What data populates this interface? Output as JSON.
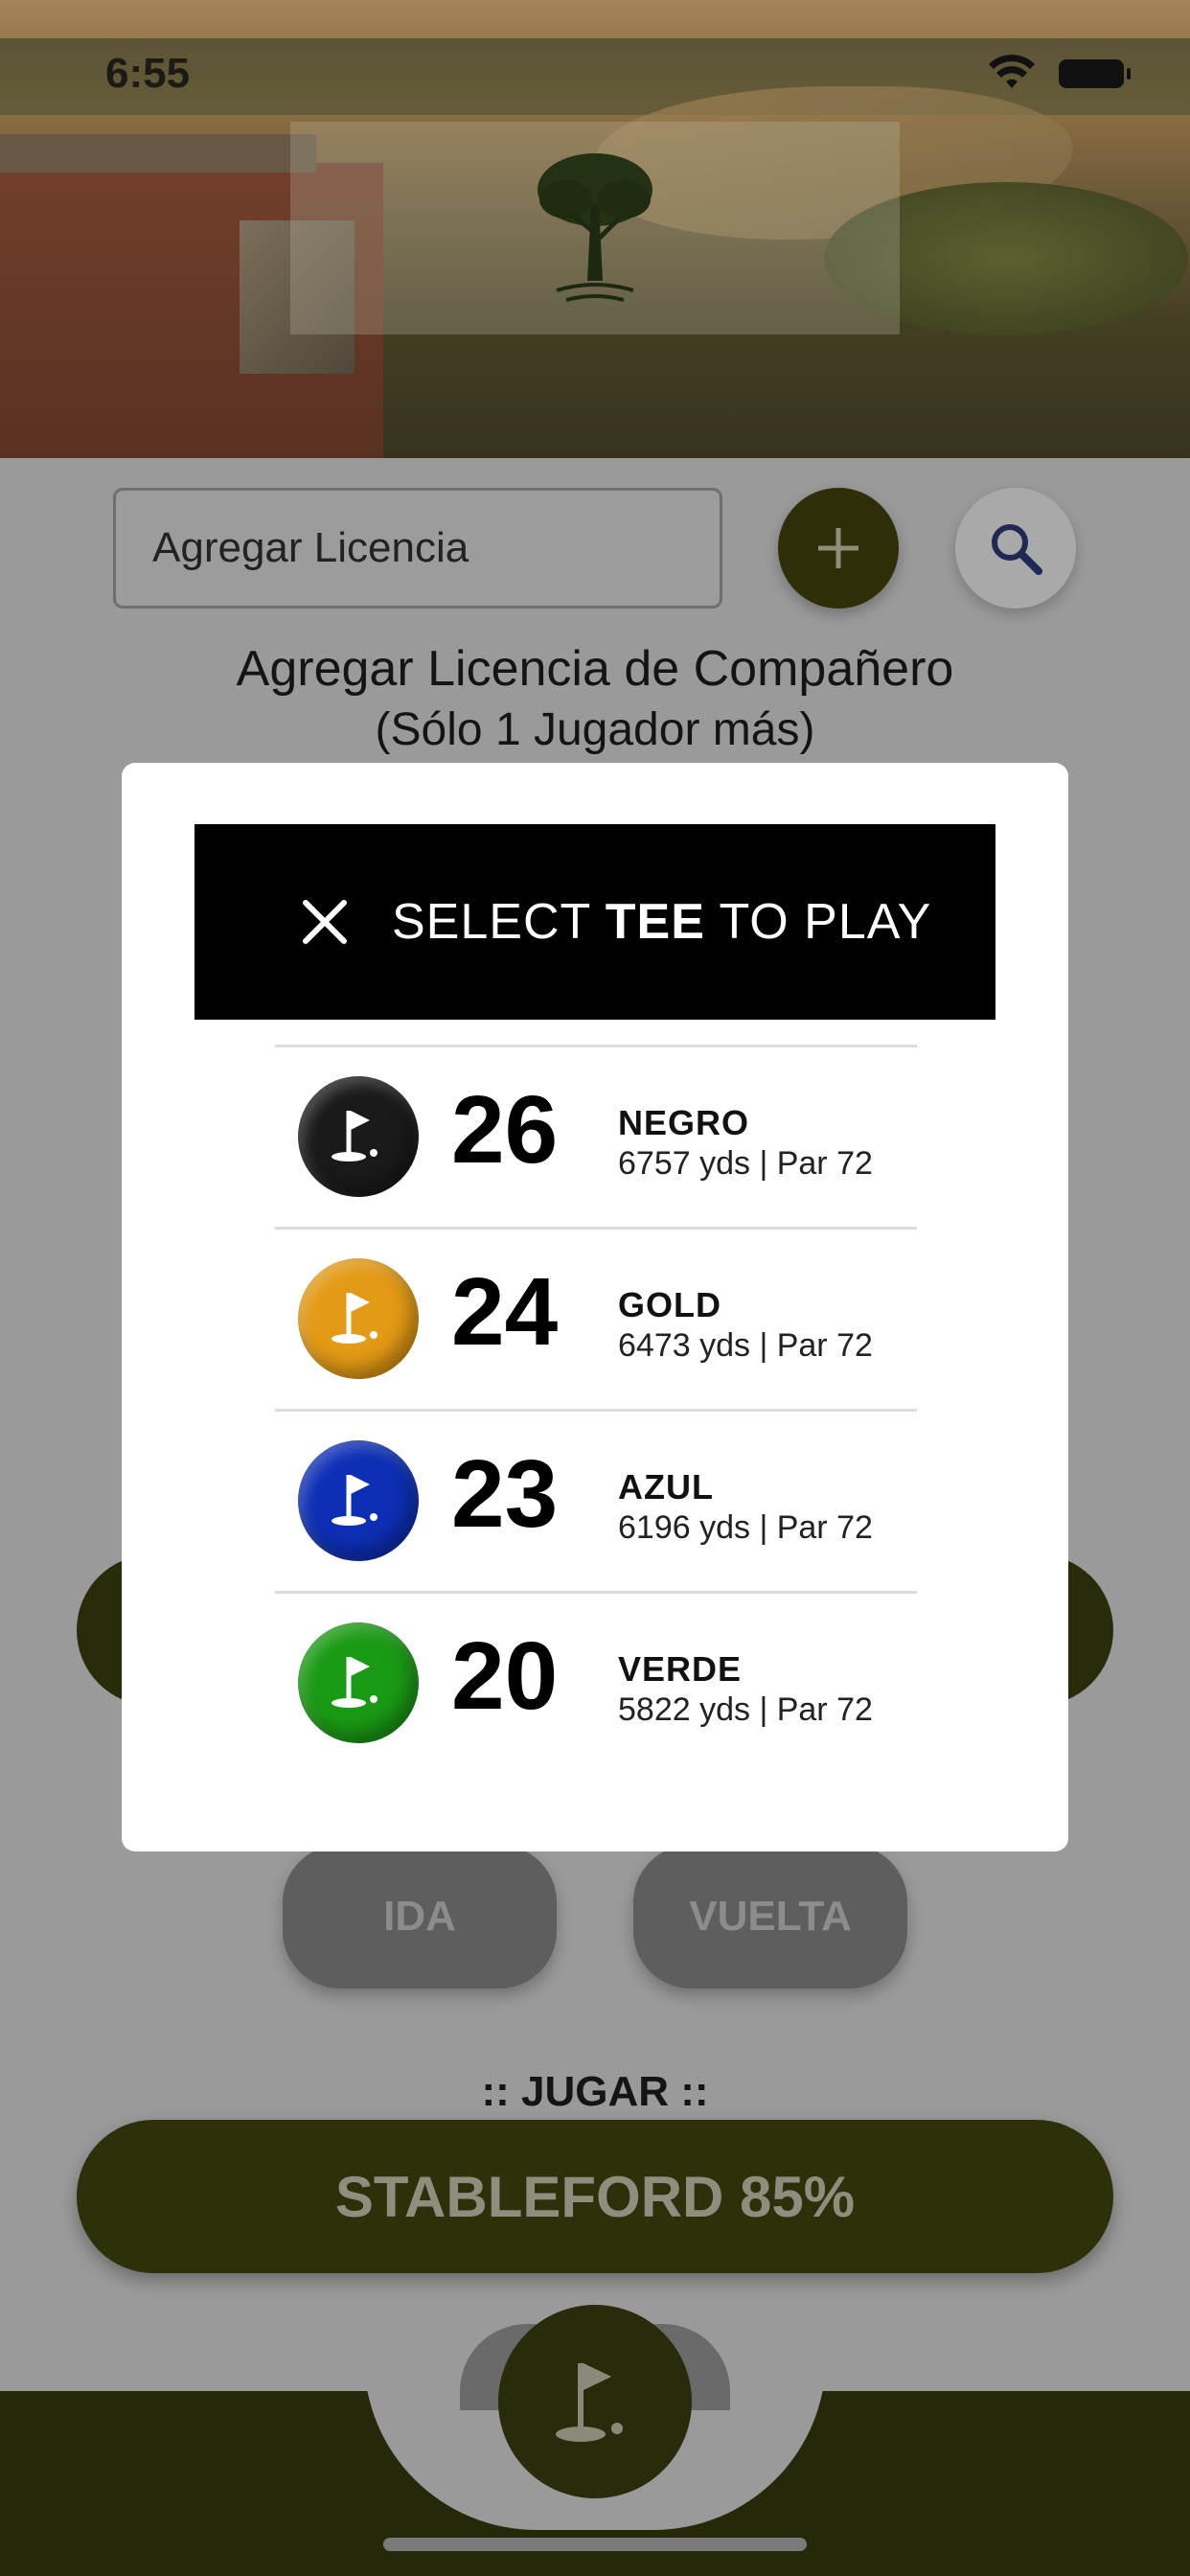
{
  "status_bar": {
    "time": "6:55"
  },
  "license": {
    "input_text": "Agregar Licencia"
  },
  "partner": {
    "title": "Agregar Licencia de Compañero",
    "subtitle": "(Sólo 1 Jugador más)"
  },
  "modal": {
    "title_prefix": "SELECT ",
    "title_bold": "TEE",
    "title_suffix": " TO PLAY",
    "tees": [
      {
        "handicap": "26",
        "name": "NEGRO",
        "info": "6757 yds | Par 72",
        "color": "#1a1a1a"
      },
      {
        "handicap": "24",
        "name": "GOLD",
        "info": "6473 yds | Par 72",
        "color": "#e39a14"
      },
      {
        "handicap": "23",
        "name": "AZUL",
        "info": "6196 yds | Par 72",
        "color": "#0d2fb5"
      },
      {
        "handicap": "20",
        "name": "VERDE",
        "info": "5822 yds | Par 72",
        "color": "#1a9a14"
      }
    ]
  },
  "round": {
    "ida_label": "IDA",
    "vuelta_label": "VUELTA"
  },
  "play": {
    "label": ":: JUGAR ::",
    "button_label": "STABLEFORD 85%"
  },
  "icons": {
    "add": "plus-icon",
    "search": "search-icon",
    "close": "close-icon",
    "tee": "golf-flag-icon",
    "logo": "tree-icon"
  },
  "colors": {
    "accent": "#2e300a",
    "modal_header": "#000000",
    "dim_background": "#9a9a9a"
  }
}
